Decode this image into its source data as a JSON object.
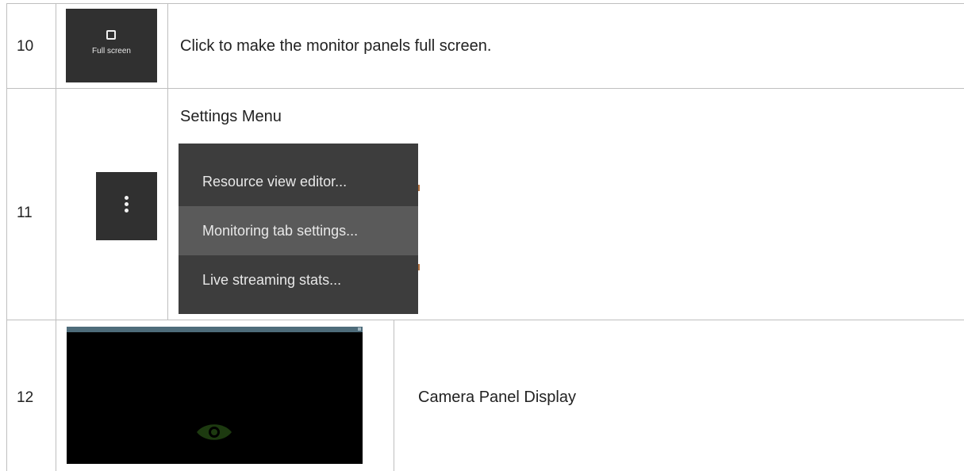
{
  "rows": [
    {
      "number": "10",
      "button": {
        "label": "Full screen",
        "icon": "fullscreen-icon"
      },
      "description": "Click to make the monitor panels full screen."
    },
    {
      "number": "11",
      "button": {
        "icon": "kebab-menu-icon"
      },
      "title": "Settings Menu",
      "menu": {
        "items": [
          "Resource view editor...",
          "Monitoring tab settings...",
          "Live streaming stats..."
        ],
        "highlighted_index": 1
      }
    },
    {
      "number": "12",
      "preview": {
        "icon": "eye-icon"
      },
      "description": "Camera Panel Display"
    }
  ],
  "colors": {
    "button_bg": "#303030",
    "menu_bg": "#3d3d3d",
    "menu_highlight": "#5a5a5a",
    "camera_header": "#4e6c7a",
    "camera_eye": "#1d3a10"
  }
}
